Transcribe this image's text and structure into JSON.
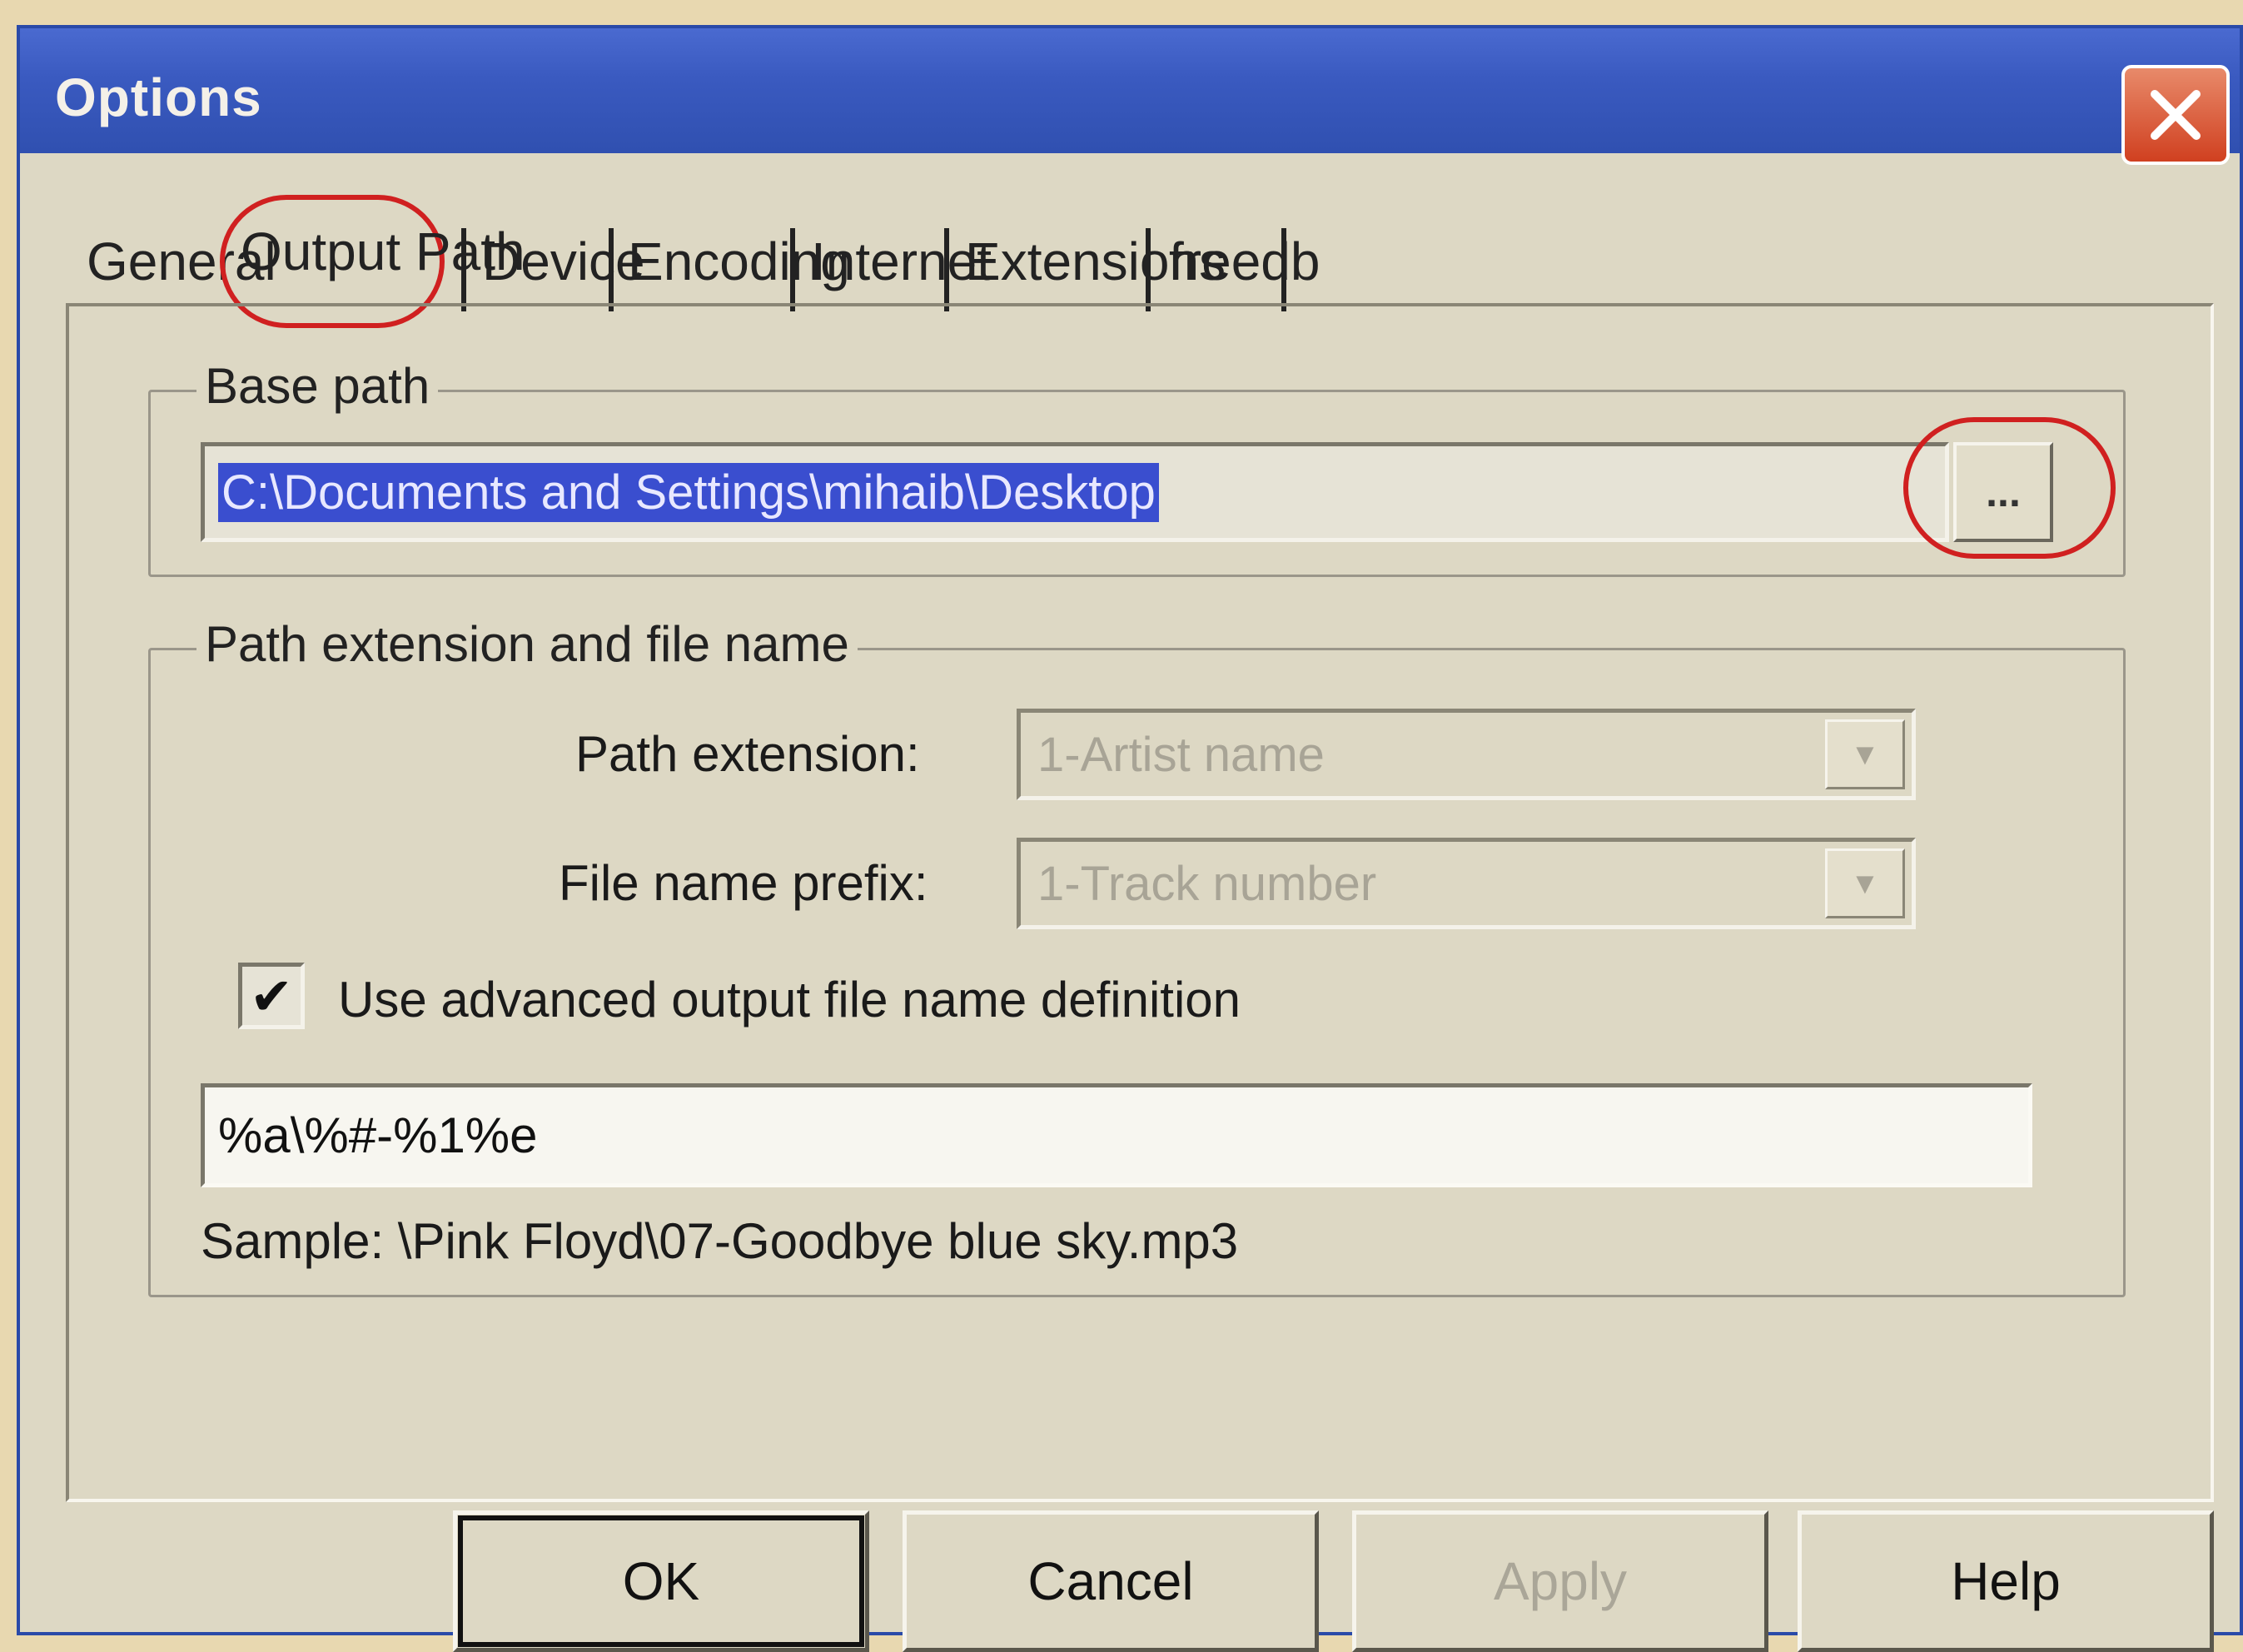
{
  "window": {
    "title": "Options"
  },
  "tabs": [
    {
      "label": "General"
    },
    {
      "label": "Output Path"
    },
    {
      "label": "Device"
    },
    {
      "label": "Encoding"
    },
    {
      "label": "Internet"
    },
    {
      "label": "Extensions"
    },
    {
      "label": "freedb"
    }
  ],
  "active_tab": "Output Path",
  "base_path": {
    "group_label": "Base path",
    "value": "C:\\Documents and Settings\\mihaib\\Desktop",
    "browse_label": "..."
  },
  "path_ext": {
    "group_label": "Path extension and file name",
    "path_extension_label": "Path extension:",
    "path_extension_value": "1-Artist name",
    "file_prefix_label": "File name prefix:",
    "file_prefix_value": "1-Track number",
    "advanced_checked": true,
    "advanced_label": "Use advanced output file name definition",
    "advanced_value": "%a\\%#-%1%e",
    "sample": "Sample: \\Pink Floyd\\07-Goodbye blue sky.mp3"
  },
  "buttons": {
    "ok": "OK",
    "cancel": "Cancel",
    "apply": "Apply",
    "help": "Help"
  },
  "colors": {
    "highlight_ring": "#d02020",
    "selection": "#3a4ecf",
    "titlebar": "#3a5ac0"
  }
}
